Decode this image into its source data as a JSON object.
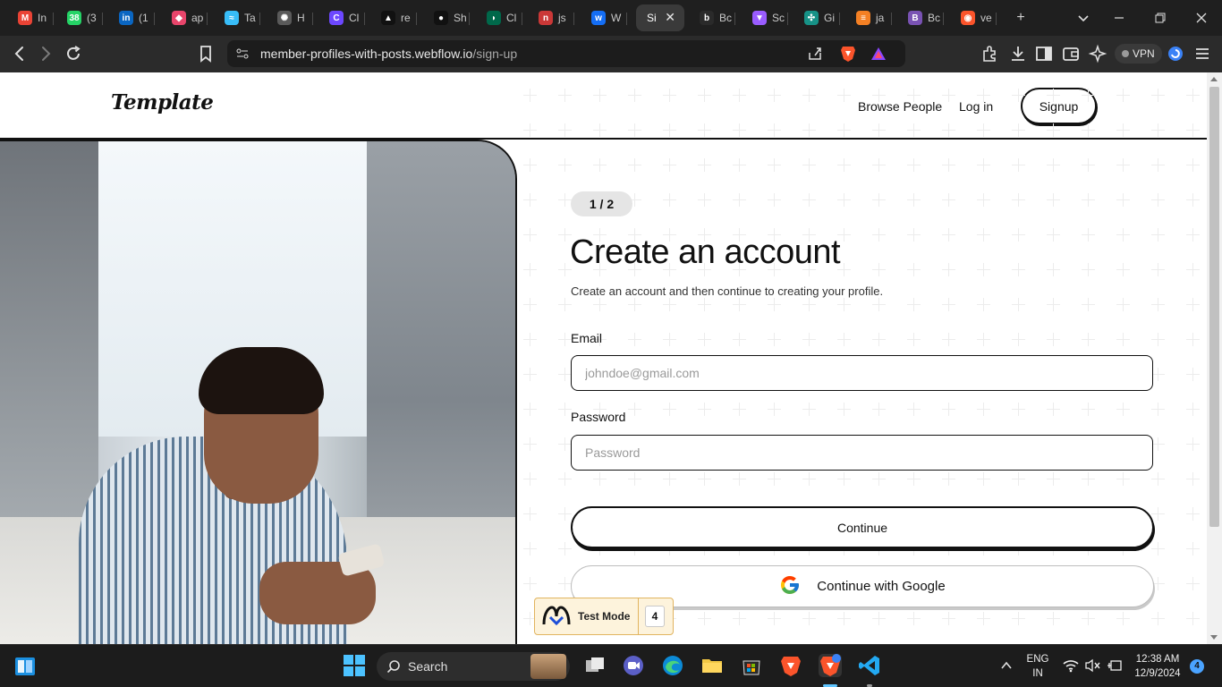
{
  "browser": {
    "tabs": [
      {
        "label": "In",
        "favicon": "gmail-icon",
        "color": "#ea4335",
        "glyph": "M"
      },
      {
        "label": "(3",
        "favicon": "whatsapp-icon",
        "color": "#25d366",
        "glyph": "38"
      },
      {
        "label": "(1",
        "favicon": "linkedin-icon",
        "color": "#0a66c2",
        "glyph": "in"
      },
      {
        "label": "ap",
        "favicon": "app-icon",
        "color": "#e8456b",
        "glyph": "◆"
      },
      {
        "label": "Ta",
        "favicon": "tailwind-icon",
        "color": "#38bdf8",
        "glyph": "≈"
      },
      {
        "label": "H",
        "favicon": "openai-icon",
        "color": "#5a5a5a",
        "glyph": "✺"
      },
      {
        "label": "Cl",
        "favicon": "clerk-icon",
        "color": "#6c47ff",
        "glyph": "C"
      },
      {
        "label": "re",
        "favicon": "vercel-icon",
        "color": "#111111",
        "glyph": "▲"
      },
      {
        "label": "Sh",
        "favicon": "github-icon",
        "color": "#111111",
        "glyph": "●"
      },
      {
        "label": "Cl",
        "favicon": "mongodb-icon",
        "color": "#00684a",
        "glyph": "◗"
      },
      {
        "label": "js",
        "favicon": "npm-icon",
        "color": "#cb3837",
        "glyph": "n"
      },
      {
        "label": "W",
        "favicon": "webflow-icon",
        "color": "#146ef5",
        "glyph": "w"
      },
      {
        "label": "Si",
        "favicon": "webflow-page-icon",
        "color": "#3a3a3a",
        "glyph": ""
      },
      {
        "label": "Bc",
        "favicon": "bolt-icon",
        "color": "#2a2a2a",
        "glyph": "b"
      },
      {
        "label": "Sc",
        "favicon": "vite-icon",
        "color": "#9a5cff",
        "glyph": "▼"
      },
      {
        "label": "Gi",
        "favicon": "gitkraken-icon",
        "color": "#179287",
        "glyph": "✣"
      },
      {
        "label": "ja",
        "favicon": "stackoverflow-icon",
        "color": "#f48024",
        "glyph": "≡"
      },
      {
        "label": "Bc",
        "favicon": "bootstrap-icon",
        "color": "#7952b3",
        "glyph": "B"
      },
      {
        "label": "ve",
        "favicon": "brave-icon",
        "color": "#fb542b",
        "glyph": "◉"
      }
    ],
    "new_tab_label": "+",
    "url_host": "member-profiles-with-posts.webflow.io",
    "url_path": "/sign-up",
    "vpn_label": "VPN"
  },
  "site": {
    "logo": "Template",
    "nav": {
      "browse_people": "Browse People",
      "log_in": "Log in",
      "signup": "Signup"
    },
    "form": {
      "step": "1 / 2",
      "title": "Create an account",
      "subtitle": "Create an account and then continue to creating your profile.",
      "email_label": "Email",
      "email_placeholder": "johndoe@gmail.com",
      "password_label": "Password",
      "password_placeholder": "Password",
      "continue": "Continue",
      "google": "Continue with Google"
    },
    "test_mode": {
      "label": "Test Mode",
      "count": "4"
    }
  },
  "taskbar": {
    "search": "Search",
    "lang_top": "ENG",
    "lang_bottom": "IN",
    "time": "12:38 AM",
    "date": "12/9/2024",
    "notifications": "4"
  }
}
